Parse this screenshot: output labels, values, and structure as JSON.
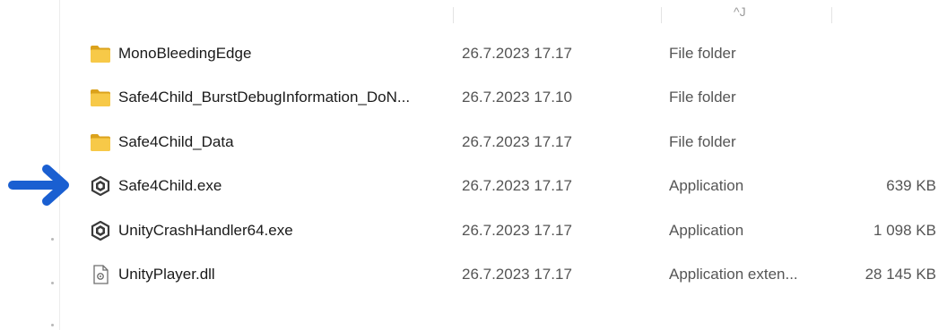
{
  "header": {
    "fragment_text": "^J"
  },
  "files": [
    {
      "name": "MonoBleedingEdge",
      "date": "26.7.2023 17.17",
      "type": "File folder",
      "size": "",
      "icon": "folder-icon"
    },
    {
      "name": "Safe4Child_BurstDebugInformation_DoN...",
      "date": "26.7.2023 17.10",
      "type": "File folder",
      "size": "",
      "icon": "folder-icon"
    },
    {
      "name": "Safe4Child_Data",
      "date": "26.7.2023 17.17",
      "type": "File folder",
      "size": "",
      "icon": "folder-icon"
    },
    {
      "name": "Safe4Child.exe",
      "date": "26.7.2023 17.17",
      "type": "Application",
      "size": "639 KB",
      "icon": "unity-exe-icon"
    },
    {
      "name": "UnityCrashHandler64.exe",
      "date": "26.7.2023 17.17",
      "type": "Application",
      "size": "1 098 KB",
      "icon": "unity-exe-icon"
    },
    {
      "name": "UnityPlayer.dll",
      "date": "26.7.2023 17.17",
      "type": "Application exten...",
      "size": "28 145 KB",
      "icon": "dll-file-icon"
    }
  ],
  "annotation": {
    "arrow_color": "#1a5fd1",
    "points_to": "Safe4Child.exe"
  },
  "colors": {
    "folder_yellow": "#f5c242",
    "folder_dark": "#dba21c",
    "unity_icon": "#3a3a3a"
  }
}
